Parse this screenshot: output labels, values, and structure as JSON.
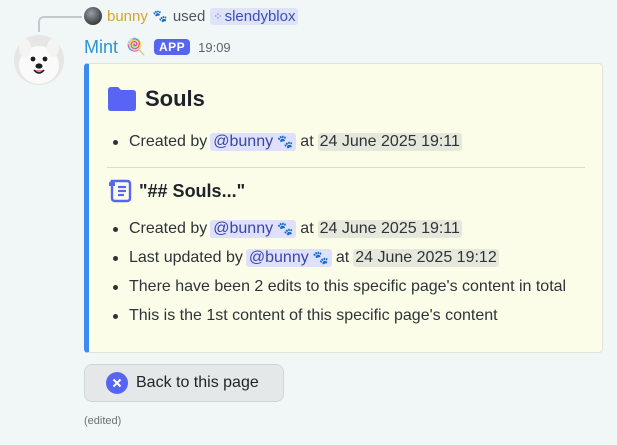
{
  "reply": {
    "user": "bunny",
    "paw": "🐾",
    "used_text": "used",
    "command": "slendyblox"
  },
  "message": {
    "bot_name": "Mint",
    "emoji": "🍭",
    "badge": "APP",
    "time": "19:09",
    "edited": "(edited)"
  },
  "embed": {
    "accent_color": "#3b8cf0",
    "title": "Souls",
    "title_icon": "folder-icon",
    "created_line": {
      "prefix": "Created by",
      "mention": "@bunny",
      "paw": "🐾",
      "at": "at",
      "timestamp": "24 June 2025 19:11"
    },
    "content_title": "\"## Souls...\"",
    "content_icon": "scroll-icon",
    "content_lines": {
      "created": {
        "prefix": "Created by",
        "mention": "@bunny",
        "paw": "🐾",
        "at": "at",
        "timestamp": "24 June 2025 19:11"
      },
      "updated": {
        "prefix": "Last updated by",
        "mention": "@bunny",
        "paw": "🐾",
        "at": "at",
        "timestamp": "24 June 2025 19:12"
      },
      "edits": "There have been 2 edits to this specific page's content in total",
      "position": "This is the 1st content of this specific page's content"
    }
  },
  "button": {
    "label": "Back to this page",
    "icon": "x-circle-icon"
  },
  "colors": {
    "background": "#f1f7f6",
    "bot_name": "#2a94d4",
    "badge": "#5865f2",
    "reply_name": "#d4a52a",
    "mention_bg": "#dee0fc"
  }
}
